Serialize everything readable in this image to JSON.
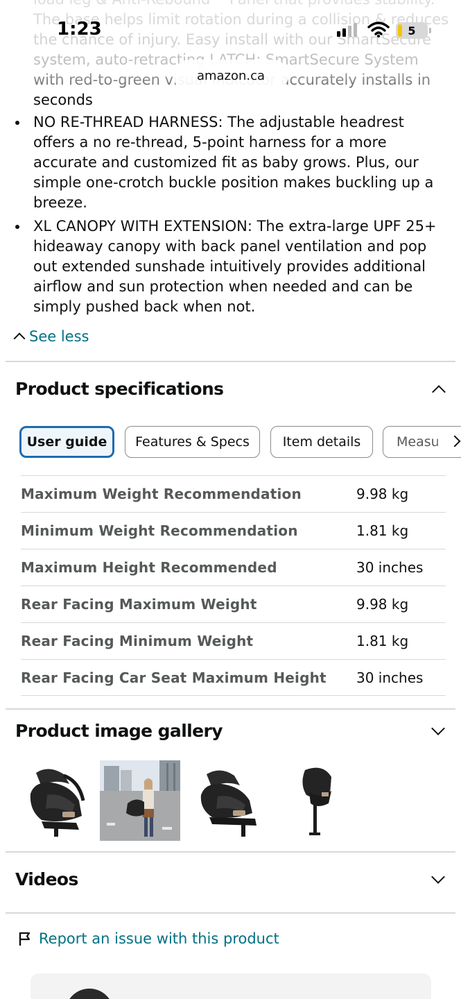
{
  "status_bar": {
    "time": "1:23",
    "battery": "5",
    "url": "amazon.ca"
  },
  "description": {
    "partial_lines": [
      "load leg & Anti-Rebound™ Panel that provides stability.",
      "The base helps limit rotation during a collision & reduces",
      "the chance of injury. Easy install with our SmartSecure",
      "system, auto-retracting LATCH: SmartSecure System",
      "with red-to-green visual indicator accurately installs in",
      "seconds"
    ],
    "bullets": [
      {
        "lines": [
          "NO RE-THREAD HARNESS: The adjustable headrest",
          "offers a no re-thread, 5-point harness for a more",
          "accurate and customized fit as baby grows. Plus, our",
          "simple one-crotch buckle position makes buckling up a",
          "breeze."
        ]
      },
      {
        "lines": [
          "XL CANOPY WITH EXTENSION: The extra-large UPF 25+",
          "hideaway canopy with back panel ventilation and pop",
          "out extended sunshade intuitively provides additional",
          "airflow and sun protection when needed and can be",
          "simply pushed back when not."
        ]
      }
    ],
    "see_less": "See less"
  },
  "specs": {
    "title": "Product specifications",
    "tabs": [
      "User guide",
      "Features & Specs",
      "Item details",
      "Measu"
    ],
    "rows": [
      {
        "label": "Maximum Weight Recommendation",
        "value": "9.98 kg"
      },
      {
        "label": "Minimum Weight Recommendation",
        "value": "1.81 kg"
      },
      {
        "label": "Maximum Height Recommended",
        "value": "30 inches"
      },
      {
        "label": "Rear Facing Maximum Weight",
        "value": "9.98 kg"
      },
      {
        "label": "Rear Facing Minimum Weight",
        "value": "1.81 kg"
      },
      {
        "label": "Rear Facing Car Seat Maximum Height",
        "value": "30 inches"
      }
    ]
  },
  "gallery": {
    "title": "Product image gallery",
    "thumbnails": [
      "car-seat-side-view",
      "person-carrying-car-seat",
      "car-seat-with-base",
      "car-seat-rear-view"
    ]
  },
  "videos": {
    "title": "Videos"
  },
  "report": {
    "label": "Report an issue with this product"
  },
  "colors": {
    "link": "#007185",
    "active_tab_border": "#1d6bb0",
    "active_tab_bg": "#eef6fc"
  }
}
